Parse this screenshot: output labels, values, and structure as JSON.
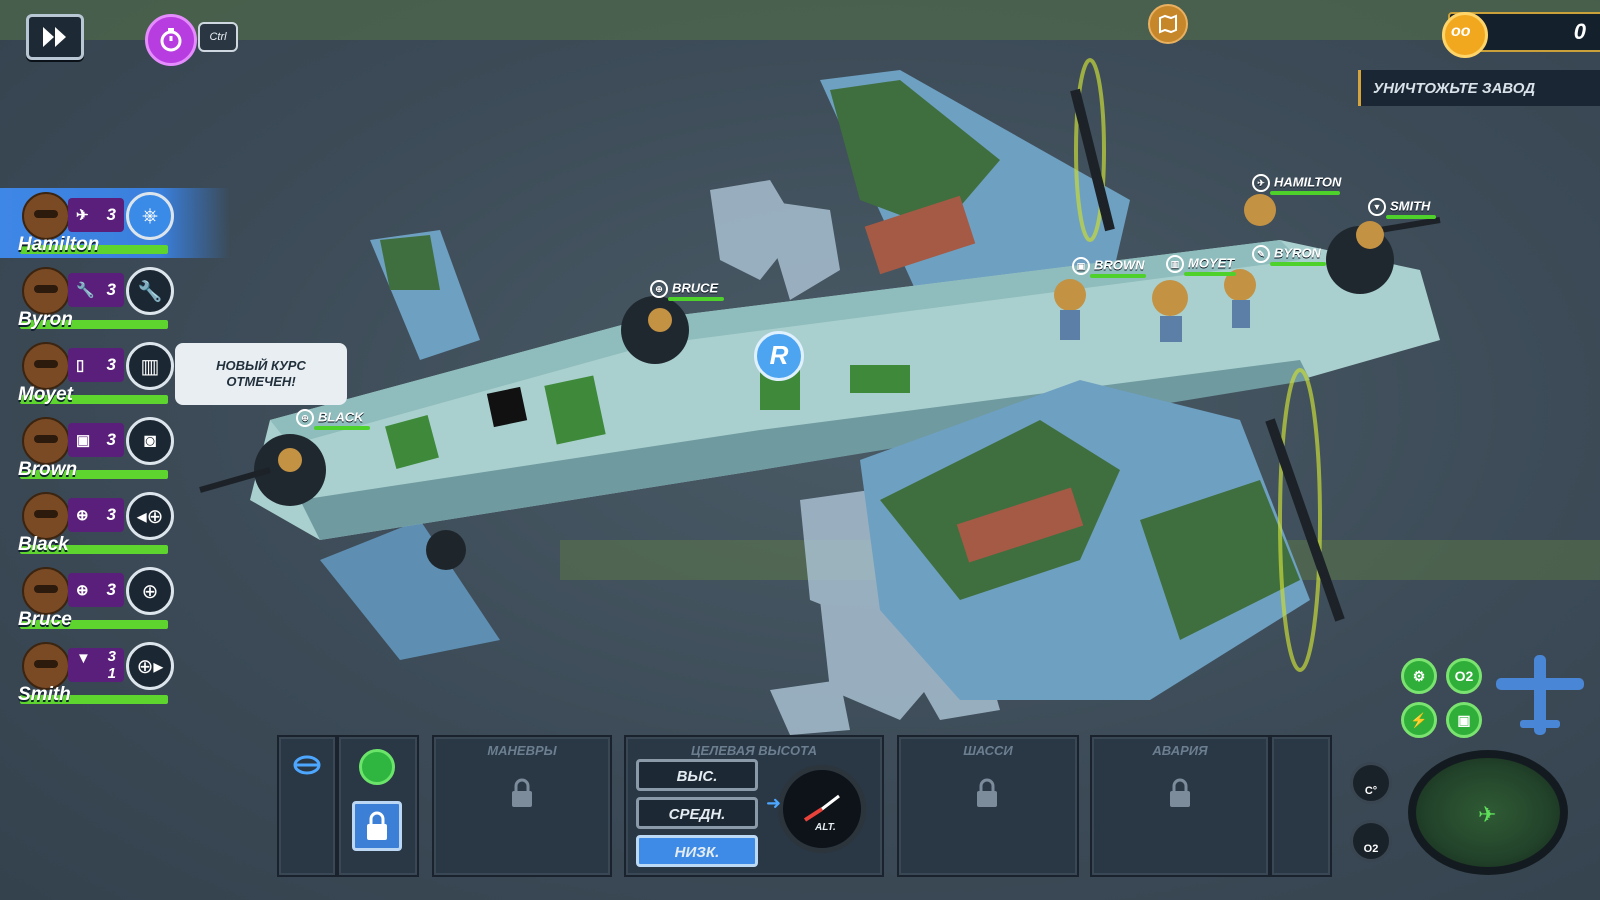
{
  "top_bar": {
    "ctrl_label": "Ctrl",
    "score": "0",
    "objective": "УНИЧТОЖЬТЕ ЗАВОД"
  },
  "crew": [
    {
      "name": "Hamilton",
      "skill_level": "3",
      "skill_icon": "pilot-icon",
      "role_icon": "steering-wheel-icon",
      "selected": true
    },
    {
      "name": "Byron",
      "skill_level": "3",
      "skill_icon": "wrench-icon",
      "role_icon": "wrench-icon",
      "selected": false
    },
    {
      "name": "Moyet",
      "skill_level": "3",
      "skill_icon": "map-icon",
      "role_icon": "map-icon",
      "selected": false
    },
    {
      "name": "Brown",
      "skill_level": "3",
      "skill_icon": "radio-icon",
      "role_icon": "radio-icon",
      "selected": false
    },
    {
      "name": "Black",
      "skill_level": "3",
      "skill_icon": "crosshair-icon",
      "role_icon": "turret-left-icon",
      "selected": false
    },
    {
      "name": "Bruce",
      "skill_level": "3",
      "skill_icon": "crosshair-icon",
      "role_icon": "turret-top-icon",
      "selected": false
    },
    {
      "name": "Smith",
      "skill_level": "3",
      "skill_level_2": "1",
      "skill_icon": "bomb-icon",
      "role_icon": "turret-right-icon",
      "selected": false
    }
  ],
  "speech_bubble": {
    "line1": "НОВЫЙ КУРС",
    "line2": "ОТМЕЧЕН!"
  },
  "plane_tags": {
    "hamilton": "HAMILTON",
    "smith": "SMITH",
    "brown": "BROWN",
    "moyet": "MOYET",
    "byron": "BYRON",
    "bruce": "BRUCE",
    "black": "BLACK"
  },
  "bottom_panel": {
    "maneuvers": "МАНЕВРЫ",
    "target_altitude": "ЦЕЛЕВАЯ ВЫСОТА",
    "alt_high": "ВЫС.",
    "alt_mid": "СРЕДН.",
    "alt_low": "НИЗК.",
    "alt_gauge_label": "ALT.",
    "landing_gear": "ШАССИ",
    "emergency": "АВАРИЯ",
    "selected_altitude": "НИЗК."
  },
  "right_hud": {
    "o2_label": "O2",
    "temp_gauge_label": "C°",
    "o2_gauge_label": "O2"
  },
  "colors": {
    "selected_crew": "#3a7fdc",
    "health_bar": "#5ed42e",
    "skill_box": "#5a1f7a",
    "active_button": "#3d8be6"
  }
}
